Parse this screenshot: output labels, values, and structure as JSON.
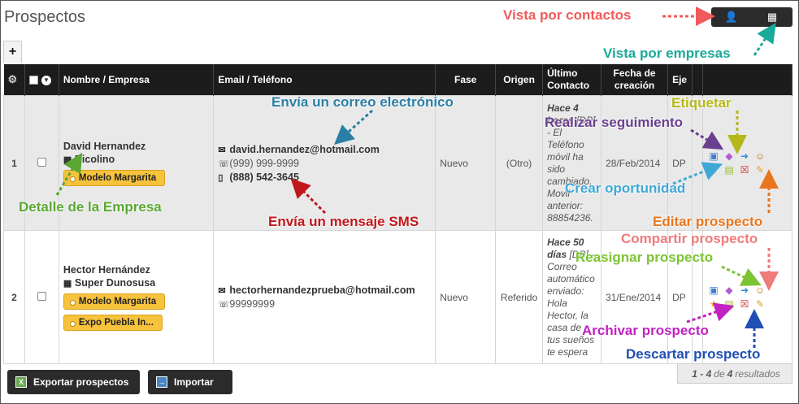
{
  "page_title": "Prospectos",
  "view_toggle": {
    "contacts_icon": "person-icon",
    "companies_icon": "building-icon"
  },
  "add_label": "+",
  "table": {
    "headers": {
      "name": "Nombre / Empresa",
      "email": "Email / Teléfono",
      "phase": "Fase",
      "origin": "Origen",
      "last_contact": "Último Contacto",
      "created": "Fecha de creación",
      "axis": "Eje"
    },
    "rows": [
      {
        "num": "1",
        "name": "David Hernandez",
        "company": "Ricolino",
        "tags": [
          "Modelo Margarita"
        ],
        "email": "david.hernandez@hotmail.com",
        "phone": "(999) 999-9999",
        "mobile": "(888) 542-3645",
        "phase": "Nuevo",
        "origin": "(Otro)",
        "last_contact_head": "Hace 4 horas",
        "last_contact_body": " [DP] - El Teléfono móvil ha sido cambiado. Movil anterior: 88854236.",
        "created": "28/Feb/2014",
        "axis": "DP"
      },
      {
        "num": "2",
        "name": "Hector Hernández",
        "company": "Super Dunosusa",
        "tags": [
          "Modelo Margarita",
          "Expo Puebla In..."
        ],
        "email": "hectorhernandezprueba@hotmail.com",
        "phone": "99999999",
        "phase": "Nuevo",
        "origin": "Referido",
        "last_contact_head": "Hace 50 días",
        "last_contact_body": " [DP] - Correo automático enviado: Hola Hector, la casa de tus sueños te espera",
        "created": "31/Ene/2014",
        "axis": "DP"
      }
    ]
  },
  "buttons": {
    "export": "Exportar prospectos",
    "import": "Importar"
  },
  "pager": {
    "range": "1 - 4",
    "of": "de",
    "total": "4",
    "suffix": "resultados"
  },
  "annotations": {
    "contacts_view": "Vista por contactos",
    "companies_view": "Vista por empresas",
    "send_email": "Envía un correo electrónico",
    "tag": "Etiquetar",
    "follow_up": "Realizar seguimiento",
    "create_opportunity": "Crear oportunidad",
    "company_detail": "Detalle de la Empresa",
    "send_sms": "Envía un mensaje SMS",
    "edit": "Editar prospecto",
    "share": "Compartir prospecto",
    "reassign": "Reasignar prospecto",
    "archive": "Archivar prospecto",
    "discard": "Descartar prospecto"
  },
  "colors": {
    "red": "#f05a5a",
    "teal": "#1aaa99",
    "blue": "#2a7fa6",
    "olive": "#b6b81a",
    "purple": "#6b3f8f",
    "lightblue": "#3fa9d6",
    "green": "#5aa832",
    "darkred": "#c0171c",
    "orange": "#e9761d",
    "pink": "#f07b7b",
    "lime": "#7cc432",
    "magenta": "#c222c2",
    "navy": "#1f4fb5"
  }
}
